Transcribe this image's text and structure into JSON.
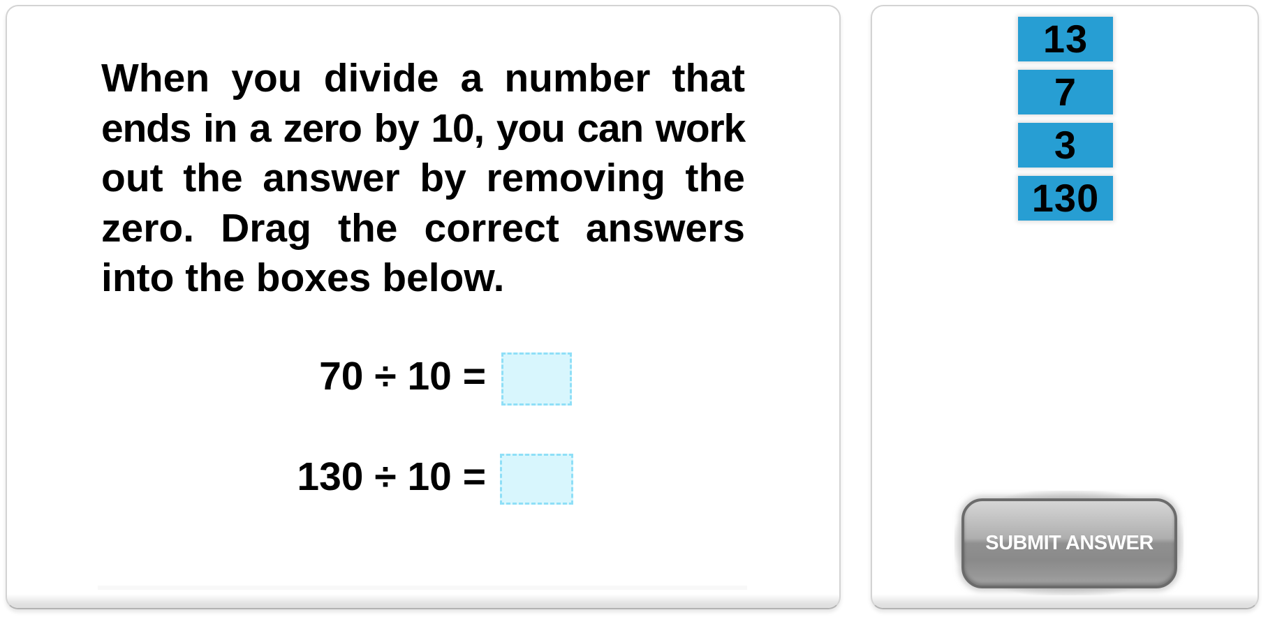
{
  "question": {
    "lines": [
      "When you divide a number that",
      "ends in a zero by 10, you can work",
      "out the answer by removing the",
      "zero. Drag the correct answers",
      "into the boxes below."
    ]
  },
  "equations": [
    {
      "expression": "70 ÷ 10 =",
      "answer": ""
    },
    {
      "expression": "130 ÷ 10 =",
      "answer": ""
    }
  ],
  "answer_tiles": [
    {
      "label": "13"
    },
    {
      "label": "7"
    },
    {
      "label": "3"
    },
    {
      "label": "130"
    }
  ],
  "submit": {
    "label": "SUBMIT ANSWER"
  },
  "colors": {
    "tile": "#279ed3",
    "drop_box_fill": "#d8f6fd",
    "drop_box_border": "#8fdff7",
    "button": "#8a8a8a"
  }
}
